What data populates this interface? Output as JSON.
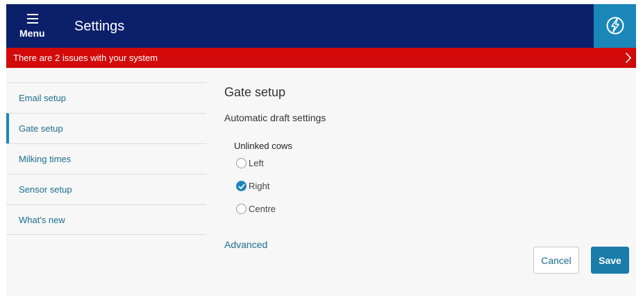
{
  "header": {
    "menu_label": "Menu",
    "title": "Settings",
    "menu_icon": "hamburger-icon",
    "action_icon": "lightning-bolt-icon",
    "bg_color": "#0b1f6b",
    "action_color": "#1a87b8"
  },
  "alert": {
    "text": "There are 2 issues with your system",
    "color": "#d20a0a",
    "icon": "chevron-right-icon"
  },
  "sidebar": {
    "items": [
      {
        "label": "Email setup",
        "active": false
      },
      {
        "label": "Gate setup",
        "active": true
      },
      {
        "label": "Milking times",
        "active": false
      },
      {
        "label": "Sensor setup",
        "active": false
      },
      {
        "label": "What's new",
        "active": false
      }
    ]
  },
  "main": {
    "section_title": "Gate setup",
    "subsection_title": "Automatic draft settings",
    "group_label": "Unlinked cows",
    "options": [
      {
        "label": "Left",
        "selected": false
      },
      {
        "label": "Right",
        "selected": true
      },
      {
        "label": "Centre",
        "selected": false
      }
    ],
    "advanced_link": "Advanced"
  },
  "actions": {
    "cancel_label": "Cancel",
    "save_label": "Save",
    "primary_color": "#1a7ca8"
  }
}
